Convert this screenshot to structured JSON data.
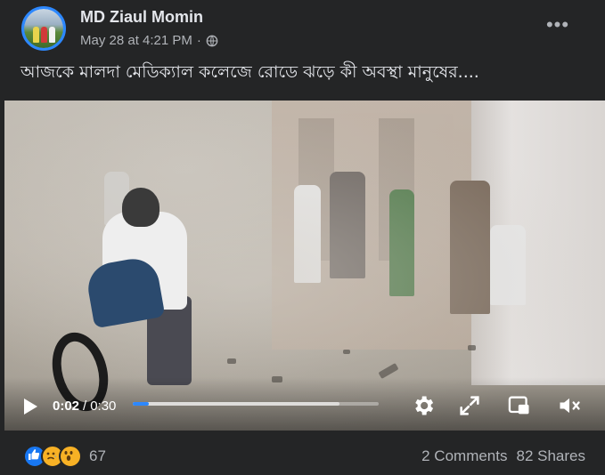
{
  "post": {
    "author": "MD Ziaul Momin",
    "timestamp": "May 28 at 4:21 PM",
    "separator": "·",
    "privacy_icon": "globe-icon",
    "more_icon": "more-options-icon",
    "caption": "আজকে মালদা মেডিক্যাল কলেজে রোডে ঝড়ে কী অবস্থা মানুষের...."
  },
  "video": {
    "current_time": "0:02",
    "time_separator": "/",
    "duration": "0:30",
    "played_fraction": 0.067,
    "buffered_fraction": 0.84,
    "icons": [
      "play-icon",
      "settings-gear-icon",
      "fullscreen-expand-icon",
      "picture-in-picture-icon",
      "volume-muted-icon"
    ],
    "accent_color": "#2d88ff"
  },
  "footer": {
    "reaction_icons": [
      "like-icon",
      "sad-icon",
      "wow-icon"
    ],
    "reaction_count": "67",
    "comments": "2 Comments",
    "shares": "82 Shares"
  },
  "colors": {
    "background": "#242526",
    "primary_text": "#e4e6eb",
    "secondary_text": "#b0b3b8"
  }
}
